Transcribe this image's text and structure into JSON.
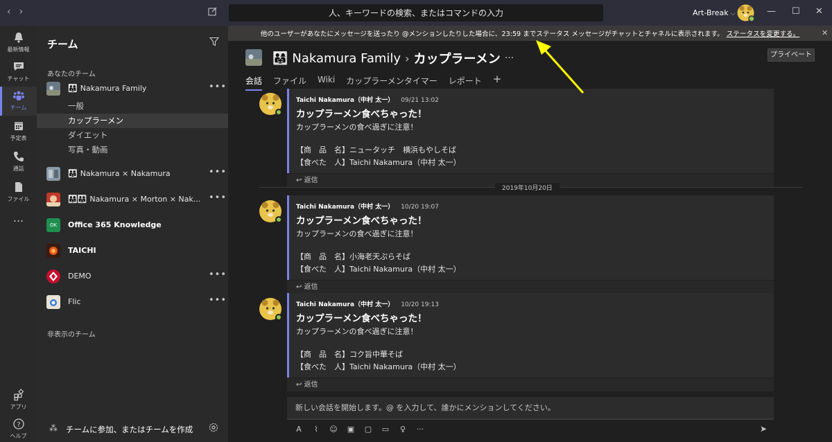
{
  "titlebar": {
    "back": "‹",
    "forward": "›",
    "search_placeholder": "人、キーワードの検索、またはコマンドの入力",
    "tenant": "Art-Break"
  },
  "rail": [
    {
      "id": "activity",
      "label": "最新情報"
    },
    {
      "id": "chat",
      "label": "チャット"
    },
    {
      "id": "teams",
      "label": "チーム"
    },
    {
      "id": "calendar",
      "label": "予定表"
    },
    {
      "id": "calls",
      "label": "通話"
    },
    {
      "id": "files",
      "label": "ファイル"
    },
    {
      "id": "more",
      "label": "..."
    },
    {
      "id": "apps",
      "label": "アプリ"
    },
    {
      "id": "help",
      "label": "ヘルプ"
    }
  ],
  "teams_panel": {
    "title": "チーム",
    "your_teams": "あなたのチーム",
    "hidden_teams": "非表示のチーム",
    "join_label": "チームに参加、またはチームを作成",
    "teams": [
      {
        "name": "Nakamura Family",
        "bold": false
      },
      {
        "name": "Nakamura × Nakamura",
        "bold": false
      },
      {
        "name": "Nakamura × Morton × Nak...",
        "bold": false
      },
      {
        "name": "Office 365 Knowledge",
        "bold": true
      },
      {
        "name": "TAICHI",
        "bold": true
      },
      {
        "name": "DEMO",
        "bold": false
      },
      {
        "name": "Flic",
        "bold": false
      }
    ],
    "channels": [
      "一般",
      "カップラーメン",
      "ダイエット",
      "写真・動画"
    ],
    "office_badge": "OK",
    "more": "•••"
  },
  "banner": {
    "text": "他のユーザーがあなたにメッセージを送ったり @メンションしたりした場合に、23:59 までステータス メッセージがチャットとチャネルに表示されます。",
    "link": "ステータスを変更する。",
    "close": "✕"
  },
  "channel_header": {
    "team": "Nakamura Family",
    "channel": "カップラーメン",
    "more": "···",
    "private_label": "プライベート",
    "tabs": [
      "会話",
      "ファイル",
      "Wiki",
      "カップラーメンタイマー",
      "レポート"
    ],
    "add_tab": "+"
  },
  "date_separator": "2019年10月20日",
  "posts": [
    {
      "author": "Taichi Nakamura（中村 太一）",
      "time": "09/21 13:02",
      "subject": "カップラーメン食べちゃった！",
      "lines": [
        "カップラーメンの食べ過ぎに注意！",
        "",
        "【商　品　名】ニュータッチ　横浜もやしそば",
        "【食べた　人】Taichi Nakamura（中村 太一）"
      ],
      "reply": "返信"
    },
    {
      "author": "Taichi Nakamura（中村 太一）",
      "time": "10/20 19:07",
      "subject": "カップラーメン食べちゃった！",
      "lines": [
        "カップラーメンの食べ過ぎに注意！",
        "",
        "【商　品　名】小海老天ぷらそば",
        "【食べた　人】Taichi Nakamura（中村 太一）"
      ],
      "reply": "返信"
    },
    {
      "author": "Taichi Nakamura（中村 太一）",
      "time": "10/20 19:13",
      "subject": "カップラーメン食べちゃった！",
      "lines": [
        "カップラーメンの食べ過ぎに注意！",
        "",
        "【商　品　名】コク旨中華そば",
        "【食べた　人】Taichi Nakamura（中村 太一）"
      ],
      "reply": "返信"
    }
  ],
  "composer": {
    "placeholder": "新しい会話を開始します。@ を入力して、誰かにメンションしてください。"
  },
  "colors": {
    "accent": "#7b83eb",
    "rail_bg": "#292929",
    "panel_bg": "#2a2a2a",
    "main_bg": "#1f1f1f",
    "annotation": "#ffff00",
    "presence": "#92c353"
  }
}
